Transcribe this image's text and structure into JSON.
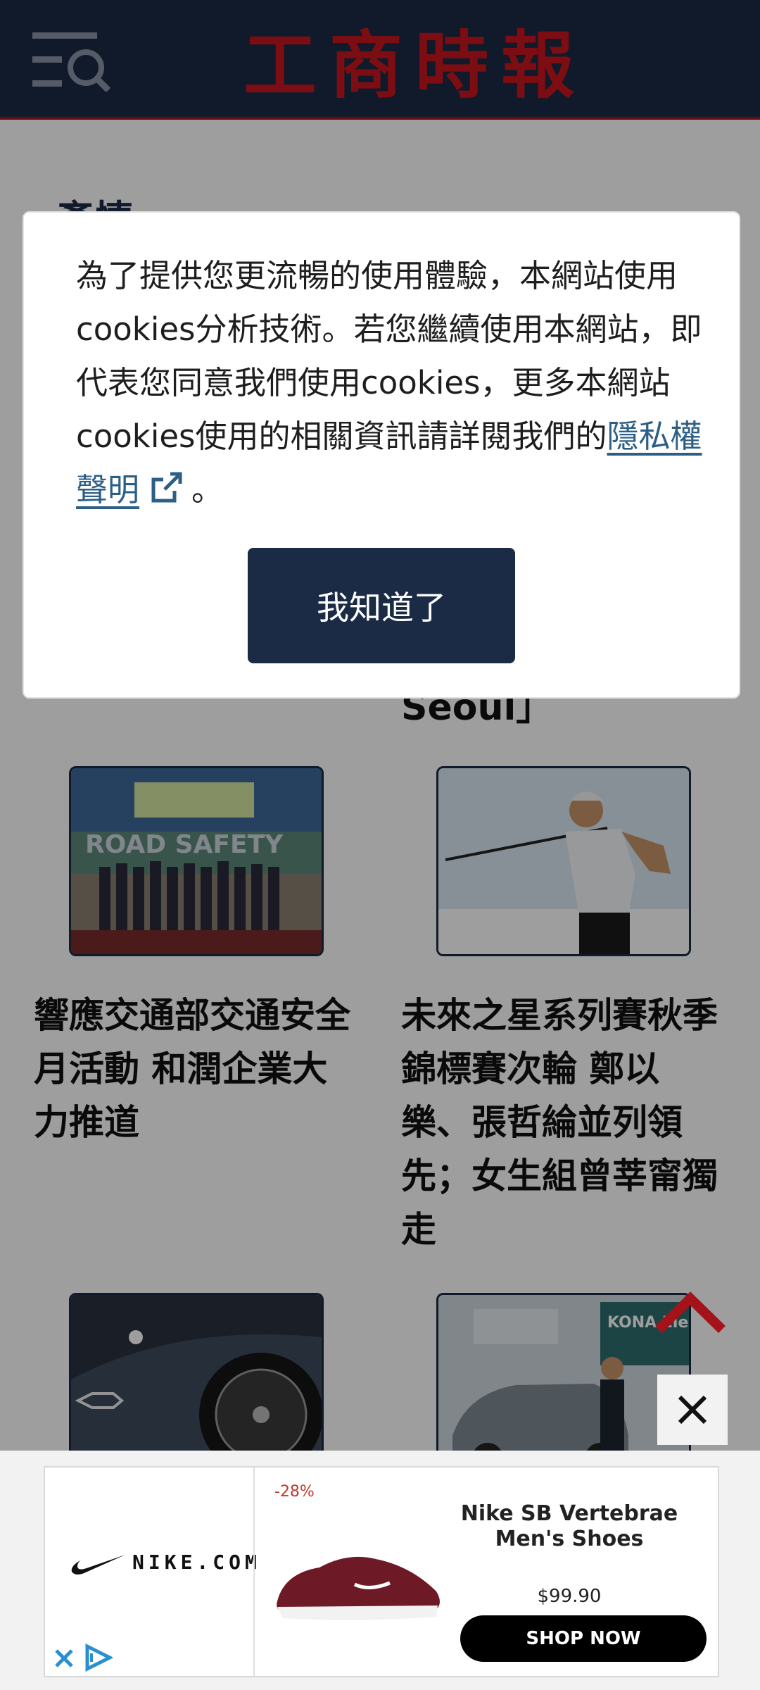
{
  "header": {
    "logo_text": "工商時報"
  },
  "page": {
    "section_title": "產情",
    "behind_text": "Seoul」",
    "cards": [
      {
        "title": "響應交通部交通安全月活動 和潤企業大力推道",
        "image_text": "ROAD SAFETY"
      },
      {
        "title": "未來之星系列賽秋季錦標賽次輪 鄭以樂、張哲綸並列領先；女生組曾莘甯獨走"
      },
      {},
      {
        "image_text": "KONA Electric"
      }
    ]
  },
  "cookie_dialog": {
    "text_before_link": "為了提供您更流暢的使用體驗，本網站使用cookies分析技術。若您繼續使用本網站，即代表您同意我們使用cookies，更多本網站cookies使用的相關資訊請詳閱我們的",
    "link_text": "隱私權聲明",
    "text_after_link": "。",
    "button_label": "我知道了"
  },
  "ad": {
    "brand": "NIKE.COM",
    "discount": "-28%",
    "product_name": "Nike SB Vertebrae Men's Shoes",
    "price": "$99.90",
    "cta": "SHOP NOW"
  },
  "colors": {
    "navy": "#1b2b45",
    "logo_red": "#c8161d",
    "link_blue": "#2c5f86"
  }
}
